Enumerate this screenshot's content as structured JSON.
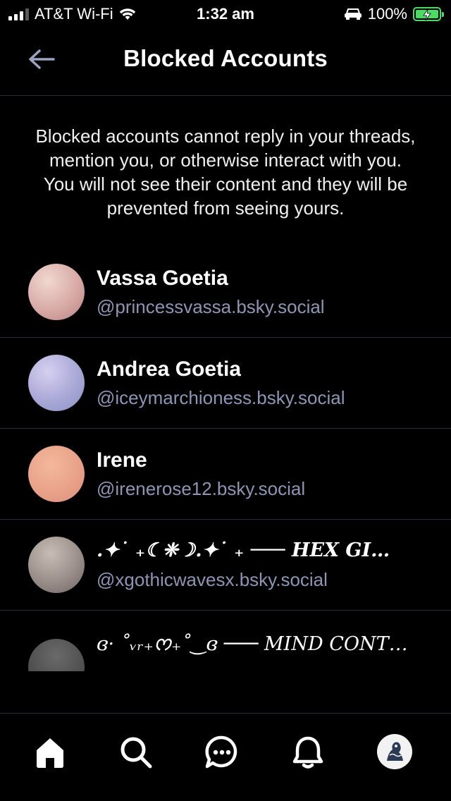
{
  "status_bar": {
    "carrier": "AT&T Wi-Fi",
    "time": "1:32 am",
    "battery": "100%"
  },
  "header": {
    "title": "Blocked Accounts"
  },
  "description": "Blocked accounts cannot reply in your threads, mention you, or otherwise interact with you. You will not see their content and they will be prevented from seeing yours.",
  "accounts": [
    {
      "name": "Vassa Goetia",
      "handle": "@princessvassa.bsky.social"
    },
    {
      "name": "Andrea Goetia",
      "handle": "@iceymarchioness.bsky.social"
    },
    {
      "name": "Irene",
      "handle": "@irenerose12.bsky.social"
    },
    {
      "name": ".✦˙ ₊☾❈☽.✦˙ ₊ ─── HEX GI…",
      "handle": "@xgothicwavesx.bsky.social"
    },
    {
      "name": "ɞ· ˚ᵥᵣ₊ᰔ₊˚‿ɞ ─── MIND CONT…",
      "handle": ""
    }
  ],
  "colors": {
    "background": "#000000",
    "divider": "#2a2d35",
    "handle": "#8c96b4",
    "battery": "#4cd964"
  },
  "tabs": [
    "home-icon",
    "search-icon",
    "chat-icon",
    "bell-icon",
    "profile-avatar"
  ]
}
